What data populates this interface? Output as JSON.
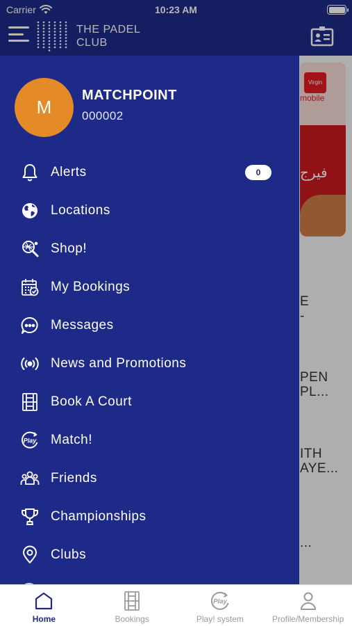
{
  "status_bar": {
    "carrier": "Carrier",
    "time": "10:23 AM"
  },
  "header": {
    "logo_line1": "THE PADEL",
    "logo_line2": "CLUB"
  },
  "background": {
    "promo_brand": "mobile",
    "promo_badge": "Virgin",
    "promo_arabic": "فيرج",
    "fragments": [
      "E",
      "-",
      "PEN",
      "PL...",
      "ITH",
      "AYE...",
      "..."
    ]
  },
  "profile": {
    "initial": "M",
    "name": "MATCHPOINT",
    "number": "000002"
  },
  "menu": {
    "items": [
      {
        "label": "Alerts",
        "icon": "bell-icon"
      },
      {
        "label": "Locations",
        "icon": "globe-icon"
      },
      {
        "label": "Shop!",
        "icon": "racket-icon"
      },
      {
        "label": "My Bookings",
        "icon": "calendar-check-icon"
      },
      {
        "label": "Messages",
        "icon": "chat-bubble-icon"
      },
      {
        "label": "News and Promotions",
        "icon": "broadcast-icon"
      },
      {
        "label": "Book A Court",
        "icon": "court-icon"
      },
      {
        "label": "Match!",
        "icon": "play-badge-icon"
      },
      {
        "label": "Friends",
        "icon": "people-group-icon"
      },
      {
        "label": "Championships",
        "icon": "trophy-icon"
      },
      {
        "label": "Clubs",
        "icon": "map-pin-icon"
      }
    ],
    "alerts_count": "0"
  },
  "tabbar": {
    "items": [
      {
        "label": "Home",
        "icon": "home-icon",
        "active": true
      },
      {
        "label": "Bookings",
        "icon": "court-icon",
        "active": false
      },
      {
        "label": "Play! system",
        "icon": "play-badge-icon",
        "active": false
      },
      {
        "label": "Profile/Membership",
        "icon": "person-icon",
        "active": false
      }
    ]
  },
  "colors": {
    "brand": "#1e2a87",
    "avatar": "#e48a27",
    "inactive_tab": "#9a9a9a"
  }
}
